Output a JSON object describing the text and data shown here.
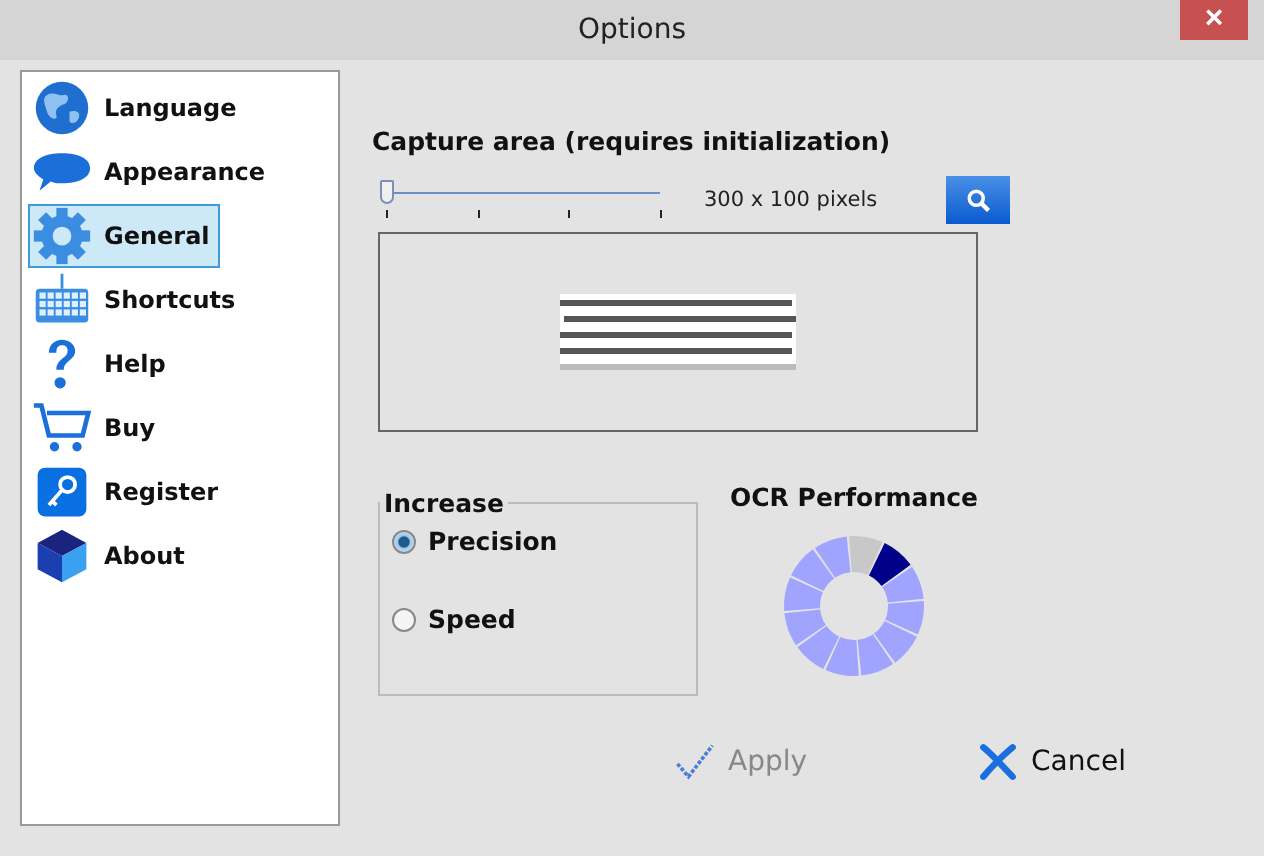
{
  "window": {
    "title": "Options",
    "close": "×"
  },
  "sidebar": {
    "items": [
      {
        "label": "Language",
        "kind": "globe",
        "selected": false
      },
      {
        "label": "Appearance",
        "kind": "bubble",
        "selected": false
      },
      {
        "label": "General",
        "kind": "gear",
        "selected": true
      },
      {
        "label": "Shortcuts",
        "kind": "keyboard",
        "selected": false
      },
      {
        "label": "Help",
        "kind": "question",
        "selected": false
      },
      {
        "label": "Buy",
        "kind": "cart",
        "selected": false
      },
      {
        "label": "Register",
        "kind": "key",
        "selected": false
      },
      {
        "label": "About",
        "kind": "cube",
        "selected": false
      }
    ]
  },
  "capture": {
    "title": "Capture area (requires initialization)",
    "slider": {
      "level": 0
    },
    "reading": "300 x 100 pixels"
  },
  "increase": {
    "legend": "Increase",
    "options": [
      {
        "label": "Precision",
        "selected": true
      },
      {
        "label": "Speed",
        "selected": false
      }
    ]
  },
  "performance": {
    "title": "OCR Performance",
    "segments": [
      {
        "kind": "inactive"
      },
      {
        "kind": "current"
      },
      {
        "kind": "active"
      },
      {
        "kind": "active"
      },
      {
        "kind": "active"
      },
      {
        "kind": "active"
      },
      {
        "kind": "active"
      },
      {
        "kind": "active"
      },
      {
        "kind": "active"
      },
      {
        "kind": "active"
      },
      {
        "kind": "active"
      },
      {
        "kind": "active"
      }
    ]
  },
  "buttons": [
    {
      "label": "Apply",
      "kind": "apply",
      "disabled": true
    },
    {
      "label": "Cancel",
      "kind": "cancel",
      "disabled": false
    }
  ]
}
